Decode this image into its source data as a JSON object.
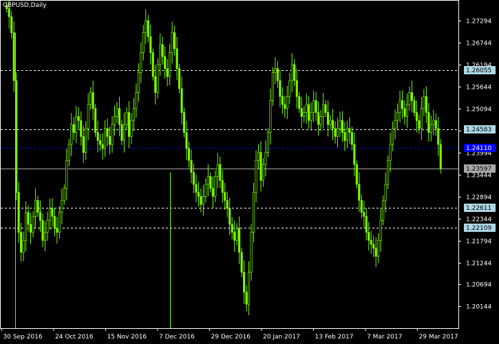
{
  "header": {
    "title": "GBPUSD,Daily"
  },
  "colors": {
    "background": "#000000",
    "frame": "#ffffff",
    "candle": "#7cfc00",
    "level_line": "#ffffff",
    "level_label_bg": "#add8e6",
    "bid_line": "#0000ff",
    "bid_label_bg": "#0000ff",
    "close_line": "#a9a9a9",
    "close_label_bg": "#a9a9a9",
    "text": "#ffffff"
  },
  "chart_data": {
    "type": "candlestick",
    "title": "GBPUSD,Daily",
    "ylim": [
      1.196,
      1.278
    ],
    "x_ticks": [
      "30 Sep 2016",
      "24 Oct 2016",
      "15 Nov 2016",
      "7 Dec 2016",
      "29 Dec 2016",
      "20 Jan 2017",
      "13 Feb 2017",
      "7 Mar 2017",
      "29 Mar 2017"
    ],
    "y_ticks": [
      "1.27294",
      "1.26744",
      "1.26194",
      "1.25644",
      "1.25094",
      "1.24544",
      "1.23994",
      "1.23444",
      "1.22894",
      "1.22344",
      "1.21794",
      "1.21244",
      "1.20694",
      "1.20144"
    ],
    "levels": [
      {
        "label": "1.26055",
        "value": 1.26055,
        "kind": "dashed"
      },
      {
        "label": "1.24583",
        "value": 1.24583,
        "kind": "dashed"
      },
      {
        "label": "1.22611",
        "value": 1.22611,
        "kind": "dashed"
      },
      {
        "label": "1.22109",
        "value": 1.22109,
        "kind": "dashed"
      }
    ],
    "bid_level": {
      "label": "1.24110",
      "value": 1.2411
    },
    "close_level": {
      "label": "1.23597",
      "value": 1.23597
    },
    "closes": [
      1.276,
      1.274,
      1.27,
      1.258,
      1.23,
      1.22,
      1.215,
      1.218,
      1.225,
      1.222,
      1.22,
      1.224,
      1.228,
      1.225,
      1.223,
      1.218,
      1.22,
      1.223,
      1.226,
      1.224,
      1.221,
      1.22,
      1.225,
      1.228,
      1.231,
      1.238,
      1.242,
      1.247,
      1.245,
      1.249,
      1.248,
      1.244,
      1.24,
      1.246,
      1.252,
      1.255,
      1.251,
      1.245,
      1.243,
      1.242,
      1.241,
      1.246,
      1.244,
      1.242,
      1.247,
      1.249,
      1.251,
      1.247,
      1.243,
      1.247,
      1.25,
      1.244,
      1.248,
      1.251,
      1.255,
      1.26,
      1.265,
      1.27,
      1.273,
      1.269,
      1.265,
      1.259,
      1.255,
      1.262,
      1.267,
      1.264,
      1.261,
      1.259,
      1.265,
      1.27,
      1.266,
      1.261,
      1.256,
      1.25,
      1.245,
      1.241,
      1.238,
      1.235,
      1.232,
      1.23,
      1.229,
      1.227,
      1.229,
      1.232,
      1.234,
      1.231,
      1.229,
      1.234,
      1.237,
      1.233,
      1.23,
      1.228,
      1.226,
      1.222,
      1.22,
      1.218,
      1.221,
      1.215,
      1.21,
      1.205,
      1.202,
      1.21,
      1.22,
      1.23,
      1.238,
      1.24,
      1.233,
      1.237,
      1.24,
      1.245,
      1.253,
      1.26,
      1.261,
      1.258,
      1.254,
      1.252,
      1.251,
      1.254,
      1.258,
      1.262,
      1.258,
      1.254,
      1.251,
      1.249,
      1.25,
      1.252,
      1.248,
      1.25,
      1.253,
      1.25,
      1.247,
      1.249,
      1.252,
      1.25,
      1.247,
      1.248,
      1.246,
      1.244,
      1.246,
      1.248,
      1.245,
      1.243,
      1.246,
      1.245,
      1.242,
      1.237,
      1.232,
      1.228,
      1.225,
      1.224,
      1.22,
      1.218,
      1.217,
      1.216,
      1.214,
      1.218,
      1.223,
      1.228,
      1.232,
      1.238,
      1.242,
      1.246,
      1.248,
      1.25,
      1.253,
      1.251,
      1.249,
      1.252,
      1.255,
      1.253,
      1.25,
      1.248,
      1.246,
      1.251,
      1.254,
      1.25,
      1.245,
      1.247,
      1.248,
      1.246,
      1.242,
      1.236
    ]
  }
}
